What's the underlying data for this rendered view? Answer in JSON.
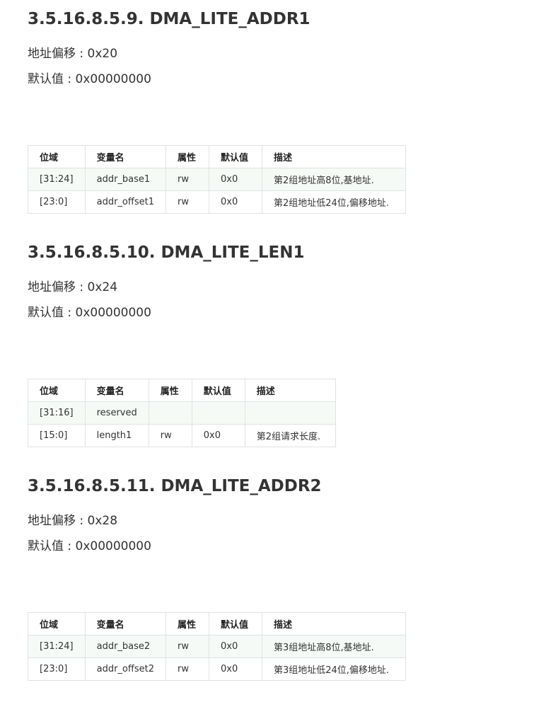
{
  "sections": [
    {
      "title": "3.5.16.8.5.9. DMA_LITE_ADDR1",
      "offset": "地址偏移 : 0x20",
      "default": "默认值 : 0x00000000",
      "headers": [
        "位域",
        "变量名",
        "属性",
        "默认值",
        "描述"
      ],
      "rows": [
        [
          "[31:24]",
          "addr_base1",
          "rw",
          "0x0",
          "第2组地址高8位,基地址."
        ],
        [
          "[23:0]",
          "addr_offset1",
          "rw",
          "0x0",
          "第2组地址低24位,偏移地址."
        ]
      ]
    },
    {
      "title": "3.5.16.8.5.10. DMA_LITE_LEN1",
      "offset": "地址偏移 : 0x24",
      "default": "默认值 : 0x00000000",
      "headers": [
        "位域",
        "变量名",
        "属性",
        "默认值",
        "描述"
      ],
      "rows": [
        [
          "[31:16]",
          "reserved",
          "",
          "",
          ""
        ],
        [
          "[15:0]",
          "length1",
          "rw",
          "0x0",
          "第2组请求长度."
        ]
      ]
    },
    {
      "title": "3.5.16.8.5.11. DMA_LITE_ADDR2",
      "offset": "地址偏移 : 0x28",
      "default": "默认值 : 0x00000000",
      "headers": [
        "位域",
        "变量名",
        "属性",
        "默认值",
        "描述"
      ],
      "rows": [
        [
          "[31:24]",
          "addr_base2",
          "rw",
          "0x0",
          "第3组地址高8位,基地址."
        ],
        [
          "[23:0]",
          "addr_offset2",
          "rw",
          "0x0",
          "第3组地址低24位,偏移地址."
        ]
      ]
    }
  ]
}
